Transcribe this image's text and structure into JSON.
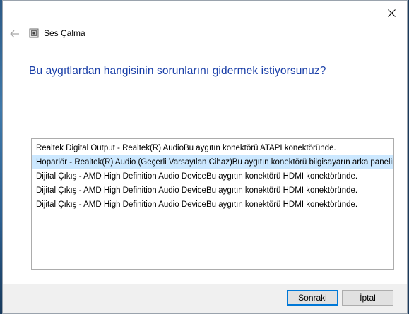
{
  "window": {
    "title": "Ses Çalma",
    "icons": {
      "close": "close-icon",
      "back": "back-arrow-icon",
      "app": "speaker-app-icon"
    }
  },
  "main": {
    "heading": "Bu aygıtlardan hangisinin sorunlarını gidermek istiyorsunuz?",
    "devices": [
      {
        "label": "Realtek Digital Output - Realtek(R) AudioBu aygıtın konektörü ATAPI konektöründe.",
        "selected": false
      },
      {
        "label": "Hoparlör - Realtek(R) Audio (Geçerli Varsayılan Cihaz)Bu aygıtın konektörü bilgisayarın arka panelinde.",
        "selected": true
      },
      {
        "label": "Dijital Çıkış - AMD High Definition Audio DeviceBu aygıtın konektörü HDMI konektöründe.",
        "selected": false
      },
      {
        "label": "Dijital Çıkış - AMD High Definition Audio DeviceBu aygıtın konektörü HDMI konektöründe.",
        "selected": false
      },
      {
        "label": "Dijital Çıkış - AMD High Definition Audio DeviceBu aygıtın konektörü HDMI konektöründe.",
        "selected": false
      }
    ]
  },
  "footer": {
    "next_label": "Sonraki",
    "cancel_label": "İptal"
  },
  "colors": {
    "heading": "#1a3fa8",
    "selection": "#cce8ff",
    "default_button_border": "#0078d7"
  }
}
